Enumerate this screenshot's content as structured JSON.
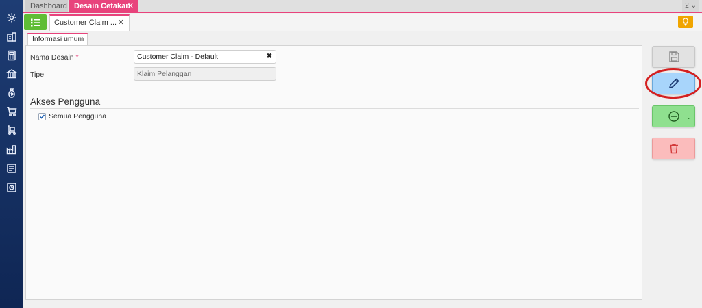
{
  "sidebar": {
    "icons": [
      "gear-icon",
      "building-icon",
      "calculator-icon",
      "bank-icon",
      "money-bag-icon",
      "cart-icon",
      "delivery-cart-icon",
      "factory-icon",
      "report-icon",
      "chart-icon"
    ]
  },
  "topbar": {
    "tabs": [
      {
        "label": "Dashboard"
      },
      {
        "label": "Desain Cetakan"
      }
    ],
    "tab_count": "2"
  },
  "doc_tab": {
    "label": "Customer Claim ..."
  },
  "inner_tab": {
    "label": "Informasi umum"
  },
  "form": {
    "nama_desain_label": "Nama Desain",
    "required_mark": "*",
    "nama_desain_value": "Customer Claim - Default",
    "tipe_label": "Tipe",
    "tipe_value": "Klaim Pelanggan"
  },
  "akses": {
    "title": "Akses Pengguna",
    "all_users_label": "Semua Pengguna",
    "all_users_checked": true
  },
  "colors": {
    "accent": "#e8437c",
    "sidebar": "#1e3d74",
    "menu_button": "#5fbd35",
    "edit_button": "#a8d5fb",
    "more_button": "#8fe08f",
    "delete_button": "#fbbcbc",
    "highlight": "#d42020"
  }
}
